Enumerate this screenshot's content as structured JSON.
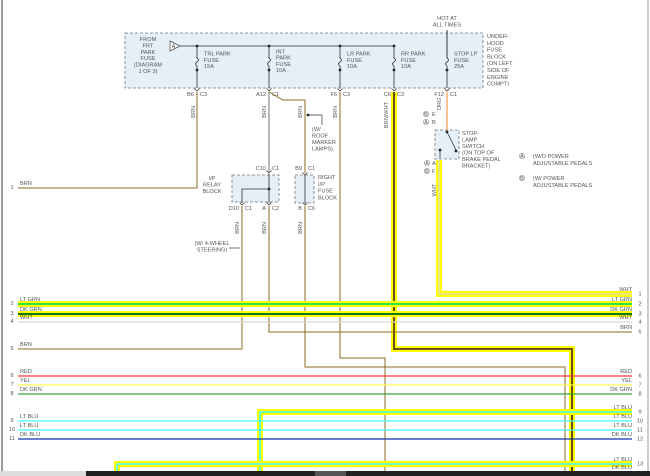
{
  "fuse_block": {
    "source_label": [
      "FROM",
      "FRT",
      "PARK",
      "FUSE",
      "(DIAGRAM",
      "1 OF 3)"
    ],
    "source_connector": "A",
    "block_label": [
      "UNDER-",
      "HOOD",
      "FUSE",
      "BLOCK",
      "(ON LEFT",
      "SIDE OF",
      "ENGINE",
      "COMPT)"
    ],
    "hot_label": [
      "HOT AT",
      "ALL TIMES"
    ],
    "fuses": [
      {
        "name": [
          "TRL PARK",
          "FUSE",
          "15A"
        ],
        "pin": "B6",
        "conn": "C3",
        "wire": "BRN"
      },
      {
        "name": [
          "INT",
          "PARK",
          "FUSE",
          "10A"
        ],
        "pin": "A12",
        "conn": "C1",
        "wire": "BRN"
      },
      {
        "name": [
          "LR PARK",
          "FUSE",
          "10A"
        ],
        "pin": "F6",
        "conn": "C3",
        "wire": "BRN"
      },
      {
        "name": [
          "RR PARK",
          "FUSE",
          "10A"
        ],
        "pin": "C6",
        "conn": "C3",
        "wire": "BRN/WHT"
      },
      {
        "name": [
          "STOP LP",
          "FUSE",
          "25A"
        ],
        "pin": "F12",
        "conn": "C1",
        "wire": "ORG"
      }
    ],
    "int_branch_wire": "BRN"
  },
  "relay_block": {
    "label": [
      "I/P",
      "RELAY",
      "BLOCK"
    ],
    "top_pin": "C10",
    "top_conn": "C1",
    "bottom_pins": [
      "D10",
      "C1",
      "A",
      "C2"
    ],
    "wires": [
      "BRN",
      "BRN"
    ]
  },
  "right_fuse_block": {
    "label": [
      "RIGHT",
      "I/P",
      "FUSE",
      "BLOCK"
    ],
    "top_pin": "B9",
    "top_conn": "C1",
    "bottom_pin": "B",
    "bottom_conn": "C6",
    "wire": "BRN"
  },
  "notes": {
    "roof": [
      "(W/",
      "ROOF",
      "MARKER",
      "LAMPS)"
    ],
    "four_wheel": [
      "(W/ 4-WHEEL",
      "STEERING)"
    ]
  },
  "stop_switch": {
    "label": [
      "STOP-",
      "LAMP",
      "SWITCH",
      "(ON TOP OF",
      "BRAKE PEDAL",
      "BRACKET)"
    ],
    "top_pins": [
      {
        "mark": "B",
        "pin": "E"
      },
      {
        "mark": "A",
        "pin": "B"
      }
    ],
    "bottom_pins": [
      {
        "mark": "A",
        "pin": "A"
      },
      {
        "mark": "B",
        "pin": "F"
      }
    ],
    "wire": "WHT"
  },
  "legend": [
    {
      "mark": "A",
      "text": [
        "(W/O POWER",
        "ADJUSTABLE PEDALS"
      ]
    },
    {
      "mark": "B",
      "text": [
        "(W/ POWER",
        "ADJUSTABLE PEDALS"
      ]
    }
  ],
  "left_circuits": [
    {
      "num": "1",
      "color": "BRN"
    },
    {
      "num": "2",
      "color": "LT GRN"
    },
    {
      "num": "3",
      "color": "DK GRN"
    },
    {
      "num": "4",
      "color": "WHT"
    },
    {
      "num": "5",
      "color": "BRN"
    },
    {
      "num": "6",
      "color": "RED"
    },
    {
      "num": "7",
      "color": "YEL"
    },
    {
      "num": "8",
      "color": "DK GRN"
    },
    {
      "num": "9",
      "color": "LT BLU"
    },
    {
      "num": "10",
      "color": "LT BLU"
    },
    {
      "num": "11",
      "color": "DK BLU"
    }
  ],
  "right_circuits": [
    {
      "num": "1",
      "color": "WHT"
    },
    {
      "num": "2",
      "color": "LT GRN"
    },
    {
      "num": "3",
      "color": "DK GRN"
    },
    {
      "num": "4",
      "color": "WHT"
    },
    {
      "num": "5",
      "color": "BRN"
    },
    {
      "num": "6",
      "color": "RED"
    },
    {
      "num": "7",
      "color": "YEL"
    },
    {
      "num": "8",
      "color": "DK GRN"
    },
    {
      "num": "9",
      "color": "LT BLU"
    },
    {
      "num": "10",
      "color": "LT BLU"
    },
    {
      "num": "11",
      "color": "LT BLU"
    },
    {
      "num": "12",
      "color": "DK BLU"
    },
    {
      "num": "13",
      "color": "LT BLU"
    },
    {
      "num": "",
      "color": "DK BLU"
    }
  ],
  "colors": {
    "brn": "#8b6a1e",
    "gray": "#888888",
    "org": "#f08a24",
    "wht": "#d8d8d8",
    "lt_grn": "#33e633",
    "dk_grn": "#127a12",
    "dk_grn2": "#3f9f3f",
    "red": "#ff3030",
    "yel": "#ffff55",
    "lt_blu": "#40ffff",
    "dk_blu": "#1234a8",
    "highlight": "#ffff00",
    "block_fill": "#e4eff8"
  }
}
